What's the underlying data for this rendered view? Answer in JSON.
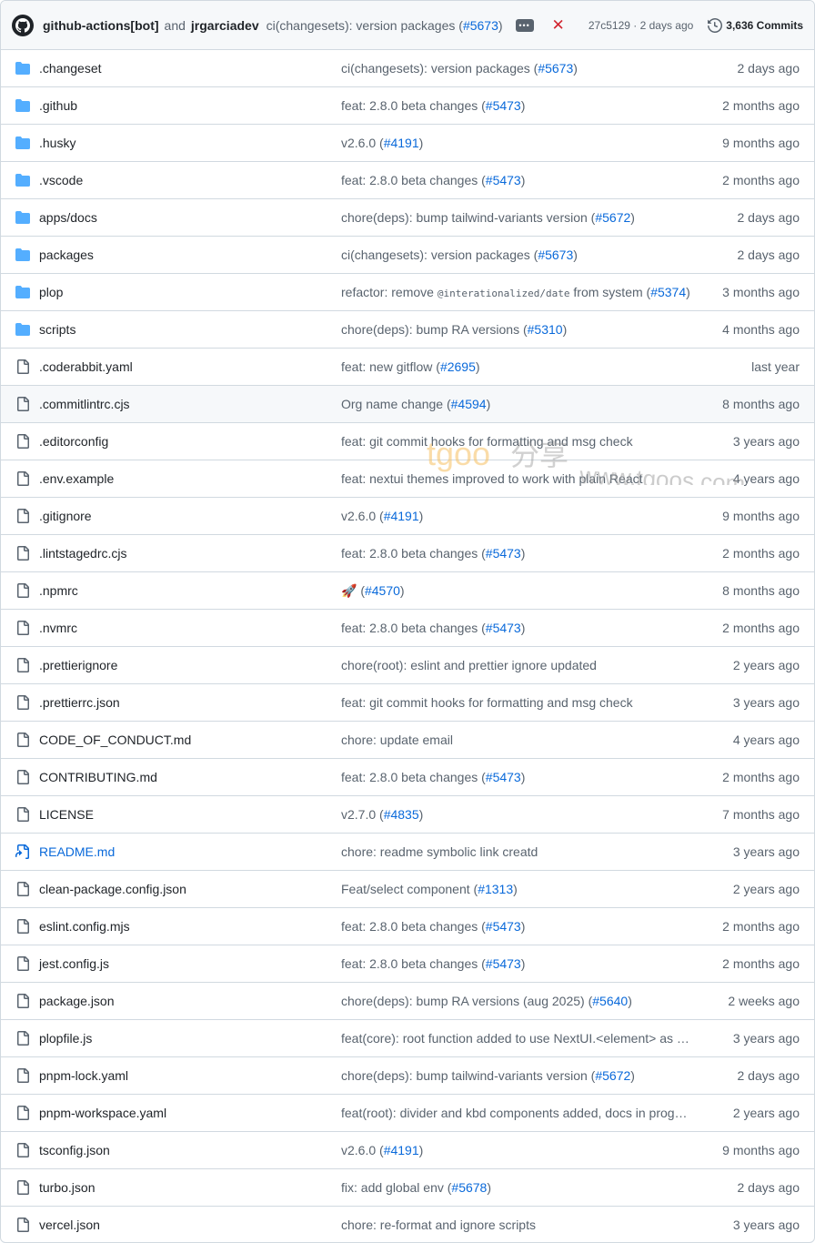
{
  "header": {
    "author": "github-actions[bot]",
    "and": "and",
    "coauthor": "jrgarciadev",
    "message_prefix": "ci(changesets): version packages (",
    "message_link": "#5673",
    "message_suffix": ")",
    "more": "•••",
    "status": "✕",
    "sha_time": "27c5129 · 2 days ago",
    "commits": "3,636 Commits"
  },
  "files": [
    {
      "type": "dir",
      "name": ".changeset",
      "msg": "ci(changesets): version packages (",
      "link": "#5673",
      "post": ")",
      "date": "2 days ago"
    },
    {
      "type": "dir",
      "name": ".github",
      "msg": "feat: 2.8.0 beta changes (",
      "link": "#5473",
      "post": ")",
      "date": "2 months ago"
    },
    {
      "type": "dir",
      "name": ".husky",
      "msg": "v2.6.0 (",
      "link": "#4191",
      "post": ")",
      "date": "9 months ago"
    },
    {
      "type": "dir",
      "name": ".vscode",
      "msg": "feat: 2.8.0 beta changes (",
      "link": "#5473",
      "post": ")",
      "date": "2 months ago"
    },
    {
      "type": "dir",
      "name": "apps/docs",
      "msg": "chore(deps): bump tailwind-variants version (",
      "link": "#5672",
      "post": ")",
      "date": "2 days ago"
    },
    {
      "type": "dir",
      "name": "packages",
      "msg": "ci(changesets): version packages (",
      "link": "#5673",
      "post": ")",
      "date": "2 days ago"
    },
    {
      "type": "dir",
      "name": "plop",
      "msg": "refactor: remove ",
      "code": "@interationalized/date",
      "msg2": " from system (",
      "link": "#5374",
      "post": ")",
      "date": "3 months ago"
    },
    {
      "type": "dir",
      "name": "scripts",
      "msg": "chore(deps): bump RA versions (",
      "link": "#5310",
      "post": ")",
      "date": "4 months ago"
    },
    {
      "type": "file",
      "name": ".coderabbit.yaml",
      "msg": "feat: new gitflow (",
      "link": "#2695",
      "post": ")",
      "date": "last year"
    },
    {
      "type": "file",
      "name": ".commitlintrc.cjs",
      "msg": "Org name change (",
      "link": "#4594",
      "post": ")",
      "date": "8 months ago",
      "highlight": true
    },
    {
      "type": "file",
      "name": ".editorconfig",
      "msg": "feat: git commit hooks for formatting and msg check",
      "date": "3 years ago"
    },
    {
      "type": "file",
      "name": ".env.example",
      "msg": "feat: nextui themes improved to work with plain React",
      "date": "4 years ago"
    },
    {
      "type": "file",
      "name": ".gitignore",
      "msg": "v2.6.0 (",
      "link": "#4191",
      "post": ")",
      "date": "9 months ago"
    },
    {
      "type": "file",
      "name": ".lintstagedrc.cjs",
      "msg": "feat: 2.8.0 beta changes (",
      "link": "#5473",
      "post": ")",
      "date": "2 months ago"
    },
    {
      "type": "file",
      "name": ".npmrc",
      "msg": "🚀 (",
      "link": "#4570",
      "post": ")",
      "date": "8 months ago"
    },
    {
      "type": "file",
      "name": ".nvmrc",
      "msg": "feat: 2.8.0 beta changes (",
      "link": "#5473",
      "post": ")",
      "date": "2 months ago"
    },
    {
      "type": "file",
      "name": ".prettierignore",
      "msg": "chore(root): eslint and prettier ignore updated",
      "date": "2 years ago"
    },
    {
      "type": "file",
      "name": ".prettierrc.json",
      "msg": "feat: git commit hooks for formatting and msg check",
      "date": "3 years ago"
    },
    {
      "type": "file",
      "name": "CODE_OF_CONDUCT.md",
      "msg": "chore: update email",
      "date": "4 years ago"
    },
    {
      "type": "file",
      "name": "CONTRIBUTING.md",
      "msg": "feat: 2.8.0 beta changes (",
      "link": "#5473",
      "post": ")",
      "date": "2 months ago"
    },
    {
      "type": "file",
      "name": "LICENSE",
      "msg": "v2.7.0 (",
      "link": "#4835",
      "post": ")",
      "date": "7 months ago"
    },
    {
      "type": "symlink",
      "name": "README.md",
      "msg": "chore: readme symbolic link creatd",
      "date": "3 years ago"
    },
    {
      "type": "file",
      "name": "clean-package.config.json",
      "msg": "Feat/select component (",
      "link": "#1313",
      "post": ")",
      "date": "2 years ago"
    },
    {
      "type": "file",
      "name": "eslint.config.mjs",
      "msg": "feat: 2.8.0 beta changes (",
      "link": "#5473",
      "post": ")",
      "date": "2 months ago"
    },
    {
      "type": "file",
      "name": "jest.config.js",
      "msg": "feat: 2.8.0 beta changes (",
      "link": "#5473",
      "post": ")",
      "date": "2 months ago"
    },
    {
      "type": "file",
      "name": "package.json",
      "msg": "chore(deps): bump RA versions (aug 2025) (",
      "link": "#5640",
      "post": ")",
      "date": "2 weeks ago"
    },
    {
      "type": "file",
      "name": "plopfile.js",
      "msg": "feat(core): root function added to use NextUI.<element> as …",
      "date": "3 years ago"
    },
    {
      "type": "file",
      "name": "pnpm-lock.yaml",
      "msg": "chore(deps): bump tailwind-variants version (",
      "link": "#5672",
      "post": ")",
      "date": "2 days ago"
    },
    {
      "type": "file",
      "name": "pnpm-workspace.yaml",
      "msg": "feat(root): divider and kbd components added, docs in prog…",
      "date": "2 years ago"
    },
    {
      "type": "file",
      "name": "tsconfig.json",
      "msg": "v2.6.0 (",
      "link": "#4191",
      "post": ")",
      "date": "9 months ago"
    },
    {
      "type": "file",
      "name": "turbo.json",
      "msg": "fix: add global env (",
      "link": "#5678",
      "post": ")",
      "date": "2 days ago"
    },
    {
      "type": "file",
      "name": "vercel.json",
      "msg": "chore: re-format and ignore scripts",
      "date": "3 years ago"
    }
  ],
  "watermark": {
    "logo": "tgoo",
    "cn": "分享",
    "url": "www.tgoos.com"
  },
  "colors": {
    "folder": "#54aeff",
    "link": "#0969da",
    "muted": "#59636e",
    "error": "#d1242f"
  }
}
